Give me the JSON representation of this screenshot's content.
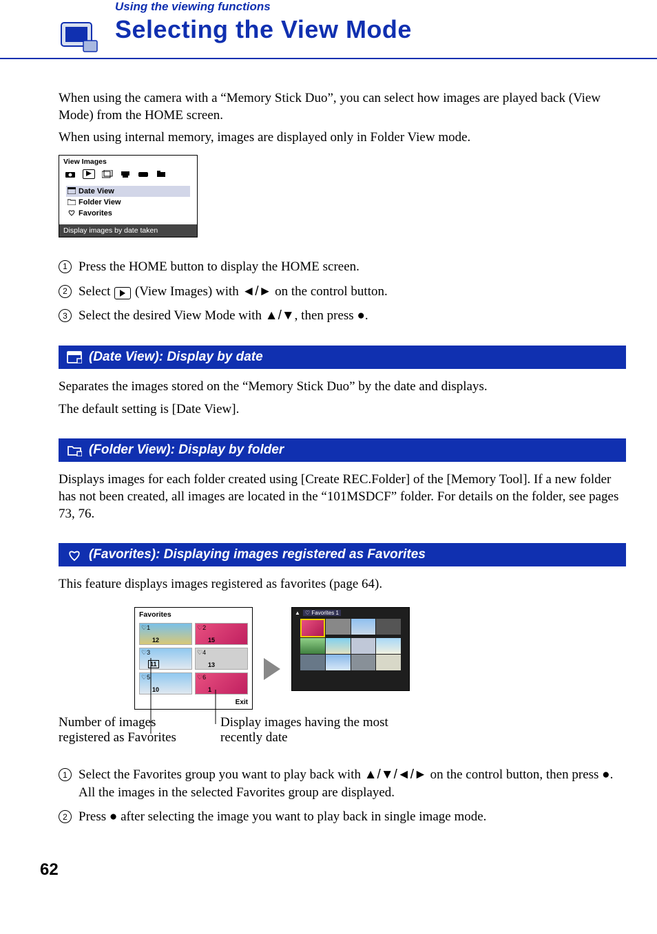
{
  "section": "Using the viewing functions",
  "title": "Selecting the View Mode",
  "intro1": "When using the camera with a “Memory Stick Duo”, you can select how images are played back (View Mode) from the HOME screen.",
  "intro2": "When using internal memory, images are displayed only in Folder View mode.",
  "screen": {
    "title": "View Images",
    "items": [
      "Date View",
      "Folder View",
      "Favorites"
    ],
    "footer": "Display images by date taken"
  },
  "steps1": {
    "1": "Press the HOME button to display the HOME screen.",
    "2a": "Select ",
    "2b": " (View Images) with ",
    "2c": " on the control button.",
    "3a": "Select the desired View Mode with ",
    "3b": ", then press ",
    "3c": "."
  },
  "headings": {
    "date": " (Date View): Display by date",
    "folder": " (Folder View): Display by folder",
    "fav": " (Favorites): Displaying images registered as Favorites"
  },
  "date_body1": "Separates the images stored on the “Memory Stick Duo” by the date and displays.",
  "date_body2": "The default setting is [Date View].",
  "folder_body": "Displays images for each folder created using [Create REC.Folder] of the [Memory Tool]. If a new folder has not been created, all images are located in the “101MSDCF” folder. For details on the folder, see pages 73, 76.",
  "fav_body": "This feature displays images registered as favorites (page 64).",
  "fav_screen": {
    "title": "Favorites",
    "cells": [
      {
        "tag": "1",
        "cnt": "12"
      },
      {
        "tag": "2",
        "cnt": "15"
      },
      {
        "tag": "3",
        "cnt": "11"
      },
      {
        "tag": "4",
        "cnt": "13"
      },
      {
        "tag": "5",
        "cnt": "10"
      },
      {
        "tag": "6",
        "cnt": "1"
      }
    ],
    "exit": "Exit",
    "preview_title": "Favorites 1"
  },
  "callouts": {
    "c1": "Number of images registered as Favorites",
    "c2": "Display images having the most recently date"
  },
  "steps2": {
    "1a": "Select the Favorites group you want to play back with ",
    "1b": " on the control button, then press ",
    "1c": ".",
    "1d": "All the images in the selected Favorites group are displayed.",
    "2a": "Press ",
    "2b": " after selecting the image you want to play back in single image mode."
  },
  "page_number": "62"
}
